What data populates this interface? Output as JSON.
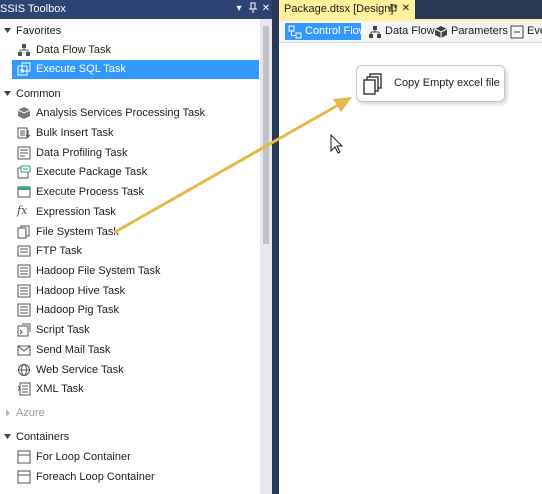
{
  "toolbox": {
    "title": "SSIS Toolbox",
    "favorites": {
      "label": "Favorites",
      "items": [
        "Data Flow Task",
        "Execute SQL Task"
      ]
    },
    "common": {
      "label": "Common",
      "items": [
        "Analysis Services Processing Task",
        "Bulk Insert Task",
        "Data Profiling Task",
        "Execute Package Task",
        "Execute Process Task",
        "Expression Task",
        "File System Task",
        "FTP Task",
        "Hadoop File System Task",
        "Hadoop Hive Task",
        "Hadoop Pig Task",
        "Script Task",
        "Send Mail Task",
        "Web Service Task",
        "XML Task"
      ]
    },
    "azure": {
      "label": "Azure"
    },
    "containers": {
      "label": "Containers",
      "items": [
        "For Loop Container",
        "Foreach Loop Container"
      ]
    }
  },
  "designer": {
    "tab_title": "Package.dtsx [Design]*",
    "subtabs": [
      "Control Flow",
      "Data Flow",
      "Parameters",
      "Eve"
    ],
    "task": {
      "label": "Copy Empty excel file"
    }
  },
  "colors": {
    "accent": "#3399ff",
    "title_bar": "#2d4373",
    "frame": "#293955",
    "active_doc_tab": "#fff29d",
    "arrow": "#e8b84a"
  }
}
